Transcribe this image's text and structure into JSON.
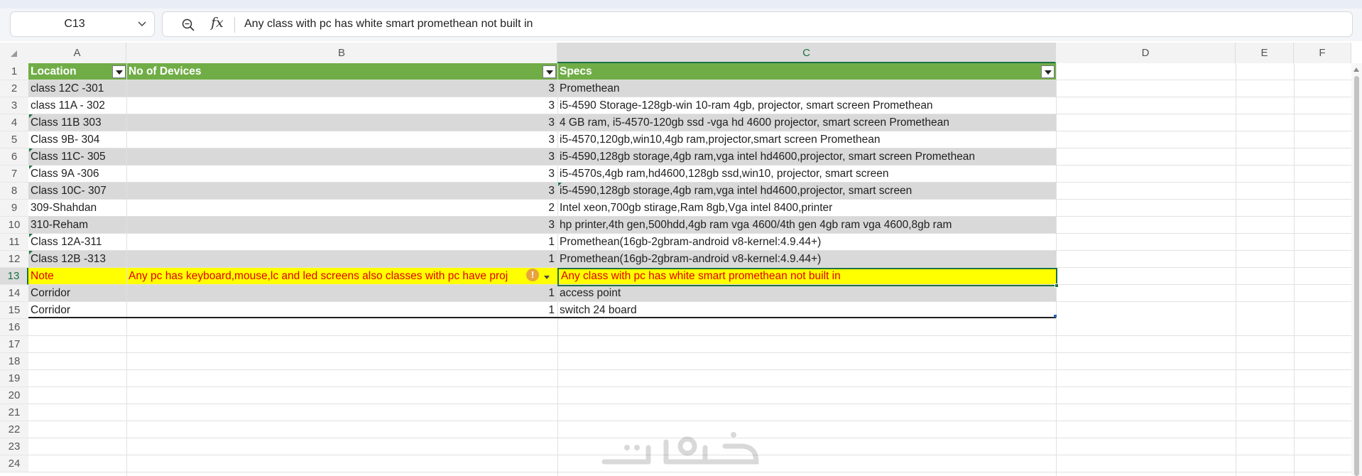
{
  "formula_bar": {
    "name_box": "C13",
    "zoom_icon": "magnifier-icon",
    "fx_label": "fx",
    "content": "Any class with pc has white smart promethean not built in"
  },
  "columns": [
    "A",
    "B",
    "C",
    "D",
    "E",
    "F"
  ],
  "active_column": "C",
  "rows": [
    "1",
    "2",
    "3",
    "4",
    "5",
    "6",
    "7",
    "8",
    "9",
    "10",
    "11",
    "12",
    "13",
    "14",
    "15",
    "16",
    "17",
    "18",
    "19",
    "20",
    "21",
    "22",
    "23",
    "24"
  ],
  "active_row": "13",
  "table": {
    "headers": {
      "location": "Location",
      "devices": "No of Devices",
      "specs": "Specs"
    },
    "data": [
      {
        "location": " class 12C -301",
        "devices": "3",
        "specs": "Promethean"
      },
      {
        "location": "class 11A - 302",
        "devices": "3",
        "specs": "i5-4590 Storage-128gb-win 10-ram 4gb, projector, smart screen Promethean"
      },
      {
        "location": " Class 11B 303",
        "devices": "3",
        "specs": "4 GB ram, i5-4570-120gb ssd -vga hd 4600 projector, smart screen Promethean"
      },
      {
        "location": "Class 9B- 304",
        "devices": "3",
        "specs": "i5-4570,120gb,win10,4gb ram,projector,smart  screen Promethean"
      },
      {
        "location": " Class 11C- 305",
        "devices": "3",
        "specs": "i5-4590,128gb storage,4gb ram,vga intel hd4600,projector, smart screen Promethean"
      },
      {
        "location": " Class 9A -306",
        "devices": "3",
        "specs": "i5-4570s,4gb ram,hd4600,128gb ssd,win10, projector, smart screen"
      },
      {
        "location": "Class 10C- 307",
        "devices": "3",
        "specs": "i5-4590,128gb storage,4gb ram,vga intel hd4600,projector, smart screen"
      },
      {
        "location": "309-Shahdan",
        "devices": "2",
        "specs": "Intel xeon,700gb stirage,Ram 8gb,Vga intel 8400,printer"
      },
      {
        "location": "310-Reham",
        "devices": "3",
        "specs": "hp printer,4th gen,500hdd,4gb ram vga 4600/4th gen 4gb ram vga 4600,8gb ram"
      },
      {
        "location": " Class 12A-311",
        "devices": "1",
        "specs": "Promethean(16gb-2gbram-android v8-kernel:4.9.44+)"
      },
      {
        "location": " Class 12B -313",
        "devices": "1",
        "specs": "Promethean(16gb-2gbram-android v8-kernel:4.9.44+)"
      },
      {
        "location": "Note",
        "devices": "Any pc has keyboard,mouse,lc and led screens also classes with pc have proj",
        "specs": " Any class with pc has white smart promethean not built in"
      },
      {
        "location": "Corridor",
        "devices": "1",
        "specs": "access point"
      },
      {
        "location": "Corridor",
        "devices": "1",
        "specs": "switch 24 board"
      }
    ]
  },
  "colors": {
    "header_green": "#70ad47",
    "band_gray": "#d9d9d9",
    "note_yellow": "#ffff00",
    "note_red": "#e00000",
    "selection_green": "#1e7145"
  }
}
